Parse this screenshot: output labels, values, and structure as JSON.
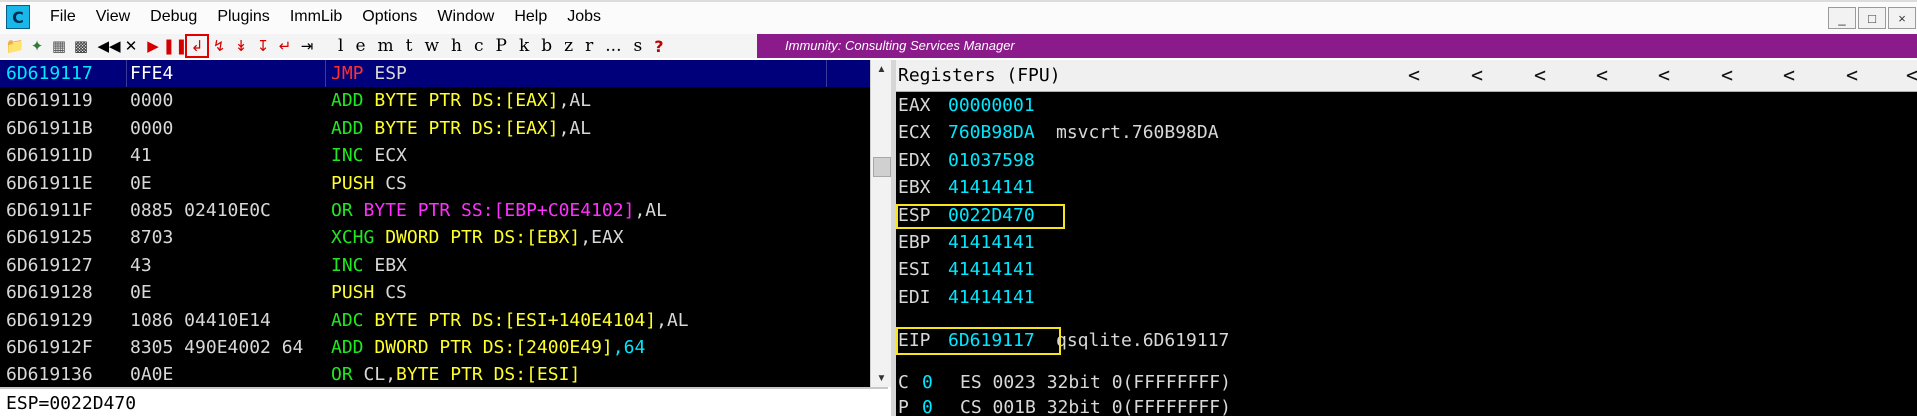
{
  "menubar": {
    "app_icon_letter": "C",
    "items": [
      "File",
      "View",
      "Debug",
      "Plugins",
      "ImmLib",
      "Options",
      "Window",
      "Help",
      "Jobs"
    ],
    "window_controls": [
      "_",
      "□",
      "×"
    ]
  },
  "toolbar": {
    "letters": [
      "l",
      "e",
      "m",
      "t",
      "w",
      "h",
      "c",
      "P",
      "k",
      "b",
      "z",
      "r",
      "...",
      "s"
    ],
    "help_label": "?",
    "banner_text": "Immunity: Consulting Services Manager"
  },
  "cpu": {
    "rows": [
      {
        "address": "6D619117",
        "hex": "FFE4",
        "asm": [
          {
            "t": "JMP",
            "c": "jmp"
          },
          {
            "t": " ESP",
            "c": "white"
          }
        ],
        "selected": true
      },
      {
        "address": "6D619119",
        "hex": "0000",
        "asm": [
          {
            "t": "ADD",
            "c": "green"
          },
          {
            "t": " BYTE PTR DS:[EAX]",
            "c": "yellow"
          },
          {
            "t": ",AL",
            "c": "white"
          }
        ]
      },
      {
        "address": "6D61911B",
        "hex": "0000",
        "asm": [
          {
            "t": "ADD",
            "c": "green"
          },
          {
            "t": " BYTE PTR DS:[EAX]",
            "c": "yellow"
          },
          {
            "t": ",AL",
            "c": "white"
          }
        ]
      },
      {
        "address": "6D61911D",
        "hex": "41",
        "asm": [
          {
            "t": "INC",
            "c": "green"
          },
          {
            "t": " ECX",
            "c": "white"
          }
        ]
      },
      {
        "address": "6D61911E",
        "hex": "0E",
        "asm": [
          {
            "t": "PUSH",
            "c": "yellow"
          },
          {
            "t": " CS",
            "c": "white"
          }
        ]
      },
      {
        "address": "6D61911F",
        "hex": "0885 02410E0C",
        "asm": [
          {
            "t": "OR",
            "c": "green"
          },
          {
            "t": " BYTE PTR SS:[EBP+C0E4102]",
            "c": "magenta"
          },
          {
            "t": ",AL",
            "c": "white"
          }
        ]
      },
      {
        "address": "6D619125",
        "hex": "8703",
        "asm": [
          {
            "t": "XCHG",
            "c": "green"
          },
          {
            "t": " DWORD PTR DS:[EBX]",
            "c": "yellow"
          },
          {
            "t": ",EAX",
            "c": "white"
          }
        ]
      },
      {
        "address": "6D619127",
        "hex": "43",
        "asm": [
          {
            "t": "INC",
            "c": "green"
          },
          {
            "t": " EBX",
            "c": "white"
          }
        ]
      },
      {
        "address": "6D619128",
        "hex": "0E",
        "asm": [
          {
            "t": "PUSH",
            "c": "yellow"
          },
          {
            "t": " CS",
            "c": "white"
          }
        ]
      },
      {
        "address": "6D619129",
        "hex": "1086 04410E14",
        "asm": [
          {
            "t": "ADC",
            "c": "green"
          },
          {
            "t": " BYTE PTR DS:[ESI+140E4104]",
            "c": "yellow"
          },
          {
            "t": ",AL",
            "c": "white"
          }
        ]
      },
      {
        "address": "6D61912F",
        "hex": "8305 490E4002 64",
        "asm": [
          {
            "t": "ADD",
            "c": "green"
          },
          {
            "t": " DWORD PTR DS:[2400E49]",
            "c": "yellow"
          },
          {
            "t": ",64",
            "c": "cyan"
          }
        ]
      },
      {
        "address": "6D619136",
        "hex": "0A0E",
        "asm": [
          {
            "t": "OR",
            "c": "green"
          },
          {
            "t": " CL,",
            "c": "white"
          },
          {
            "t": "BYTE PTR DS:[ESI]",
            "c": "yellow"
          }
        ]
      }
    ]
  },
  "status_text": "ESP=0022D470",
  "registers": {
    "title": "Registers (FPU)",
    "nav_glyph": "<",
    "rows": [
      {
        "name": "EAX",
        "value": "00000001",
        "extra": ""
      },
      {
        "name": "ECX",
        "value": "760B98DA",
        "extra": "msvcrt.760B98DA"
      },
      {
        "name": "EDX",
        "value": "01037598",
        "extra": ""
      },
      {
        "name": "EBX",
        "value": "41414141",
        "extra": ""
      },
      {
        "name": "ESP",
        "value": "0022D470",
        "extra": "",
        "boxed": true
      },
      {
        "name": "EBP",
        "value": "41414141",
        "extra": ""
      },
      {
        "name": "ESI",
        "value": "41414141",
        "extra": ""
      },
      {
        "name": "EDI",
        "value": "41414141",
        "extra": ""
      }
    ],
    "eip": {
      "name": "EIP",
      "value": "6D619117",
      "extra": "qsqlite.6D619117"
    },
    "flags": [
      {
        "name": "C",
        "value": "0",
        "rest": "ES 0023 32bit 0(FFFFFFFF)"
      },
      {
        "name": "P",
        "value": "0",
        "rest": "CS 001B 32bit 0(FFFFFFFF)"
      }
    ]
  },
  "colors": {
    "selected_row": "#00007a",
    "banner": "#8b1a8b",
    "highlight_box": "#f5e51a",
    "toolbar_highlight": "#e00000"
  },
  "icons": [
    "open-folder-icon",
    "run-script-icon",
    "window-icon",
    "python-icon",
    "rewind-icon",
    "close-x-icon",
    "play-icon",
    "pause-icon",
    "step-into-icon",
    "step-over-icon",
    "trace-into-icon",
    "trace-over-icon",
    "execute-till-return-icon",
    "go-to-address-icon"
  ]
}
